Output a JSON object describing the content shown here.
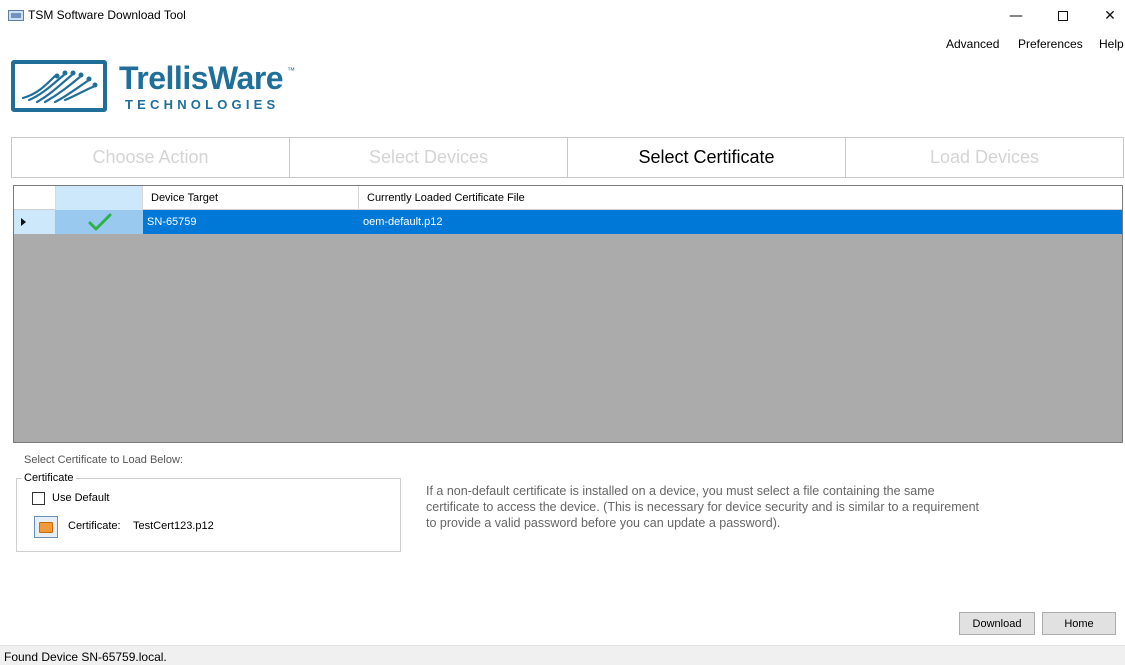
{
  "window": {
    "title": "TSM Software Download Tool",
    "minimize_glyph": "—",
    "close_glyph": "✕"
  },
  "menu": {
    "items": [
      {
        "label": "Advanced"
      },
      {
        "label": "Preferences"
      },
      {
        "label": "Help"
      }
    ]
  },
  "logo": {
    "name": "TrellisWare",
    "trademark": "™",
    "sub": "TECHNOLOGIES",
    "brand_color": "#1f6f9a"
  },
  "steps": [
    {
      "label": "Choose Action",
      "state": "disabled"
    },
    {
      "label": "Select Devices",
      "state": "disabled"
    },
    {
      "label": "Select Certificate",
      "state": "active"
    },
    {
      "label": "Load Devices",
      "state": "disabled"
    }
  ],
  "grid": {
    "columns": [
      "Device Target",
      "Currently Loaded Certificate File"
    ],
    "rows": [
      {
        "checked": true,
        "device_target": "SN-65759",
        "certificate_file": "oem-default.p12"
      }
    ],
    "selection_color": "#0078d7",
    "empty_area_color": "#ababab"
  },
  "certificate": {
    "caption": "Select Certificate to Load Below:",
    "group_label": "Certificate",
    "use_default_label": "Use Default",
    "use_default_checked": false,
    "cert_label": "Certificate:",
    "cert_value": "TestCert123.p12",
    "browse_icon": "folder-icon"
  },
  "info_text": "If a non-default certificate is installed on a device, you must select a file containing the same certificate to access the device. (This is necessary for device security and is similar to a requirement to provide a valid password before you can update a password).",
  "buttons": {
    "download": "Download",
    "home": "Home"
  },
  "status": {
    "text": "Found Device SN-65759.local."
  }
}
